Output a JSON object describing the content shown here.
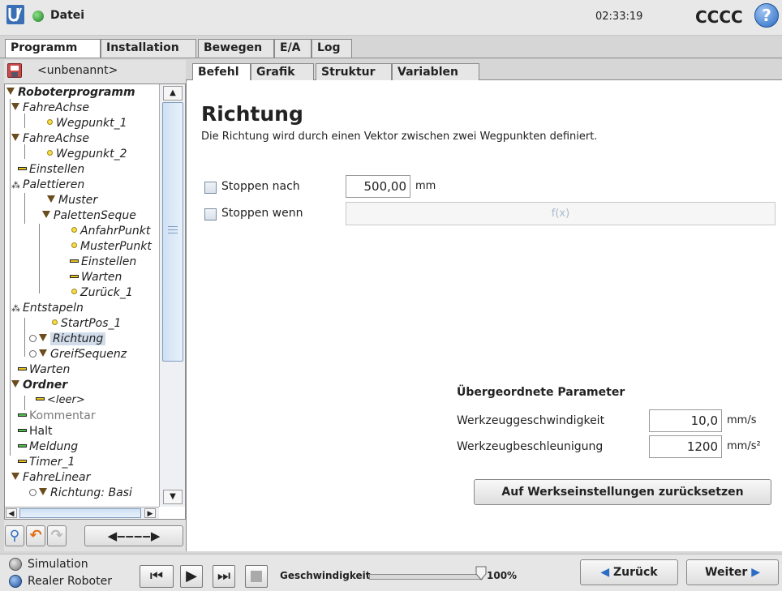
{
  "header": {
    "menu_label": "Datei",
    "clock": "02:33:19",
    "robot_name": "CCCC",
    "help_icon": "question-icon"
  },
  "main_tabs": [
    "Programm",
    "Installation",
    "Bewegen",
    "E/A",
    "Log"
  ],
  "file": {
    "name": "<unbenannt>"
  },
  "sub_tabs": [
    "Befehl",
    "Grafik",
    "Struktur",
    "Variablen"
  ],
  "tree": {
    "root": "Roboterprogramm",
    "nodes": [
      "FahreAchse",
      "Wegpunkt_1",
      "FahreAchse",
      "Wegpunkt_2",
      "Einstellen",
      "Palettieren",
      "Muster",
      "PalettenSeque",
      "AnfahrPunkt",
      "MusterPunkt",
      "Einstellen",
      "Warten",
      "Zurück_1",
      "Entstapeln",
      "StartPos_1",
      "Richtung",
      "GreifSequenz",
      "Warten",
      "Ordner",
      "<leer>",
      "Kommentar",
      "Halt",
      "Meldung",
      "Timer_1",
      "FahreLinear",
      "Richtung: Basi"
    ]
  },
  "command": {
    "title": "Richtung",
    "description": "Die Richtung wird durch einen Vektor zwischen zwei Wegpunkten definiert.",
    "stop_after_label": "Stoppen nach",
    "stop_after_value": "500,00",
    "stop_after_unit": "mm",
    "stop_when_label": "Stoppen wenn",
    "stop_when_placeholder": "f(x)"
  },
  "parent_params": {
    "heading": "Übergeordnete Parameter",
    "speed_label": "Werkzeuggeschwindigkeit",
    "speed_value": "10,0",
    "speed_unit": "mm/s",
    "accel_label": "Werkzeugbeschleunigung",
    "accel_value": "1200",
    "accel_unit": "mm/s²",
    "reset_label": "Auf Werkseinstellungen zurücksetzen"
  },
  "footer": {
    "simulation_label": "Simulation",
    "real_robot_label": "Realer Roboter",
    "speed_label": "Geschwindigkeit",
    "speed_percent": "100%",
    "speed_fraction": 1.0,
    "back_label": "Zurück",
    "next_label": "Weiter"
  },
  "colors": {
    "logo": "#3a6fb5",
    "run_dot": "#2e9e2e",
    "help": "#2b6cc4",
    "selection": "#d0dcea"
  }
}
